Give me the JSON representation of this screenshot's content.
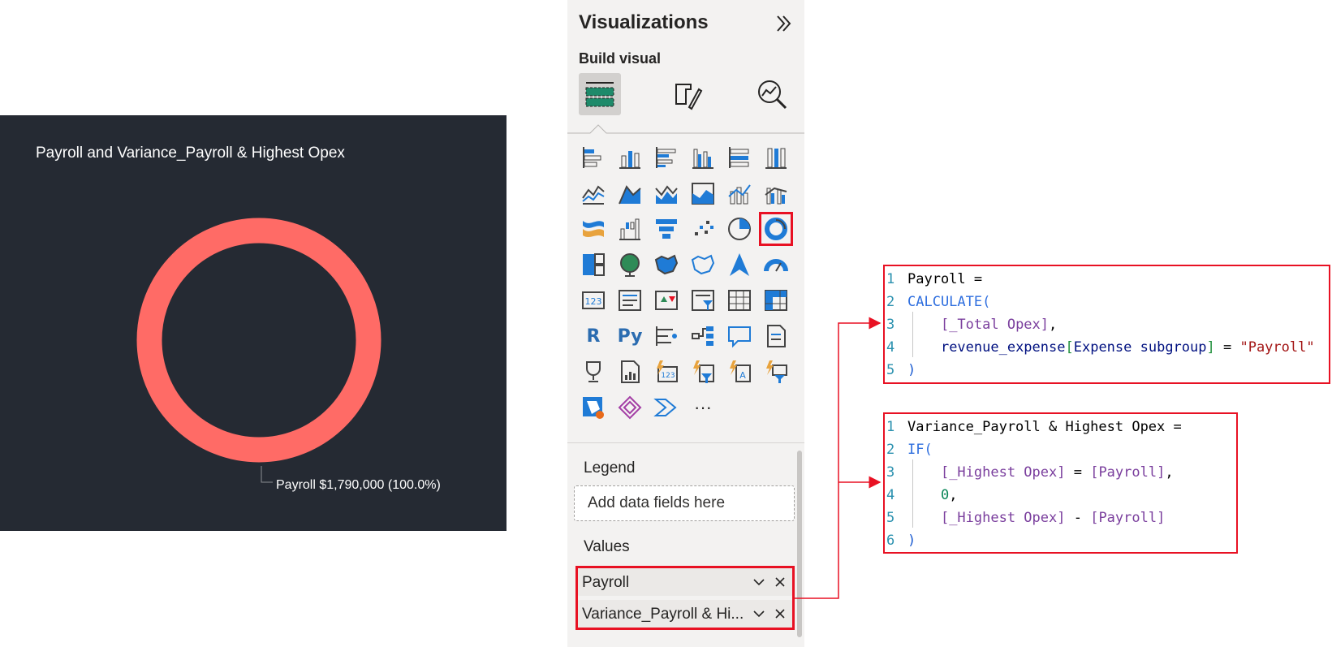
{
  "visual": {
    "title": "Payroll and Variance_Payroll & Highest Opex",
    "data_label": "Payroll $1,790,000 (100.0%)",
    "slice_color": "#ff6b66",
    "background": "#252a33"
  },
  "chart_data": {
    "type": "pie",
    "variant": "donut",
    "title": "Payroll and Variance_Payroll & Highest Opex",
    "slices": [
      {
        "label": "Payroll",
        "value": 1790000,
        "percent": 100.0,
        "color": "#ff6b66"
      }
    ],
    "data_labels": [
      "Payroll $1,790,000 (100.0%)"
    ]
  },
  "pane": {
    "title": "Visualizations",
    "collapse_icon": "double-chevron-right-icon",
    "build_label": "Build visual",
    "tabs": [
      "build-visual-icon",
      "format-visual-icon",
      "analytics-icon"
    ],
    "more_label": "···",
    "legend_label": "Legend",
    "legend_placeholder": "Add data fields here",
    "values_label": "Values",
    "values": [
      "Payroll",
      "Variance_Payroll & Hi..."
    ]
  },
  "code": {
    "payroll": {
      "line_numbers": [
        "1",
        "2",
        "3",
        "4",
        "5"
      ],
      "name": "Payroll =",
      "fn": "CALCULATE(",
      "arg1_measure": "[_Total Opex]",
      "comma": ",",
      "arg2_table": "revenue_expense",
      "arg2_column": "Expense subgroup",
      "arg2_eq": " = ",
      "arg2_value": "\"Payroll\"",
      "close": ")"
    },
    "variance": {
      "line_numbers": [
        "1",
        "2",
        "3",
        "4",
        "5",
        "6"
      ],
      "name": "Variance_Payroll & Highest Opex =",
      "fn": "IF(",
      "cond_left": "[_Highest Opex]",
      "cond_eq": " = ",
      "cond_right": "[Payroll]",
      "comma": ",",
      "then_value": "0",
      "else_left": "[_Highest Opex]",
      "else_op": " - ",
      "else_right": "[Payroll]",
      "close": ")"
    }
  },
  "colors": {
    "highlight": "#e81123",
    "accent_blue": "#1f7bd6"
  }
}
